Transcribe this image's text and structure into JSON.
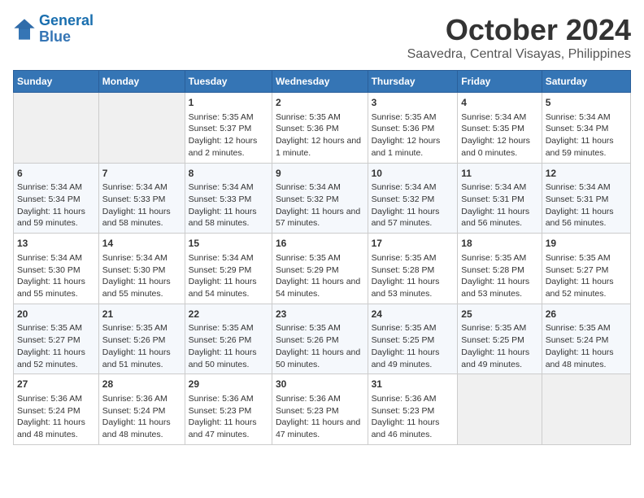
{
  "header": {
    "logo_line1": "General",
    "logo_line2": "Blue",
    "month": "October 2024",
    "location": "Saavedra, Central Visayas, Philippines"
  },
  "days_of_week": [
    "Sunday",
    "Monday",
    "Tuesday",
    "Wednesday",
    "Thursday",
    "Friday",
    "Saturday"
  ],
  "weeks": [
    [
      {
        "day": "",
        "empty": true
      },
      {
        "day": "",
        "empty": true
      },
      {
        "day": "1",
        "sunrise": "Sunrise: 5:35 AM",
        "sunset": "Sunset: 5:37 PM",
        "daylight": "Daylight: 12 hours and 2 minutes."
      },
      {
        "day": "2",
        "sunrise": "Sunrise: 5:35 AM",
        "sunset": "Sunset: 5:36 PM",
        "daylight": "Daylight: 12 hours and 1 minute."
      },
      {
        "day": "3",
        "sunrise": "Sunrise: 5:35 AM",
        "sunset": "Sunset: 5:36 PM",
        "daylight": "Daylight: 12 hours and 1 minute."
      },
      {
        "day": "4",
        "sunrise": "Sunrise: 5:34 AM",
        "sunset": "Sunset: 5:35 PM",
        "daylight": "Daylight: 12 hours and 0 minutes."
      },
      {
        "day": "5",
        "sunrise": "Sunrise: 5:34 AM",
        "sunset": "Sunset: 5:34 PM",
        "daylight": "Daylight: 11 hours and 59 minutes."
      }
    ],
    [
      {
        "day": "6",
        "sunrise": "Sunrise: 5:34 AM",
        "sunset": "Sunset: 5:34 PM",
        "daylight": "Daylight: 11 hours and 59 minutes."
      },
      {
        "day": "7",
        "sunrise": "Sunrise: 5:34 AM",
        "sunset": "Sunset: 5:33 PM",
        "daylight": "Daylight: 11 hours and 58 minutes."
      },
      {
        "day": "8",
        "sunrise": "Sunrise: 5:34 AM",
        "sunset": "Sunset: 5:33 PM",
        "daylight": "Daylight: 11 hours and 58 minutes."
      },
      {
        "day": "9",
        "sunrise": "Sunrise: 5:34 AM",
        "sunset": "Sunset: 5:32 PM",
        "daylight": "Daylight: 11 hours and 57 minutes."
      },
      {
        "day": "10",
        "sunrise": "Sunrise: 5:34 AM",
        "sunset": "Sunset: 5:32 PM",
        "daylight": "Daylight: 11 hours and 57 minutes."
      },
      {
        "day": "11",
        "sunrise": "Sunrise: 5:34 AM",
        "sunset": "Sunset: 5:31 PM",
        "daylight": "Daylight: 11 hours and 56 minutes."
      },
      {
        "day": "12",
        "sunrise": "Sunrise: 5:34 AM",
        "sunset": "Sunset: 5:31 PM",
        "daylight": "Daylight: 11 hours and 56 minutes."
      }
    ],
    [
      {
        "day": "13",
        "sunrise": "Sunrise: 5:34 AM",
        "sunset": "Sunset: 5:30 PM",
        "daylight": "Daylight: 11 hours and 55 minutes."
      },
      {
        "day": "14",
        "sunrise": "Sunrise: 5:34 AM",
        "sunset": "Sunset: 5:30 PM",
        "daylight": "Daylight: 11 hours and 55 minutes."
      },
      {
        "day": "15",
        "sunrise": "Sunrise: 5:34 AM",
        "sunset": "Sunset: 5:29 PM",
        "daylight": "Daylight: 11 hours and 54 minutes."
      },
      {
        "day": "16",
        "sunrise": "Sunrise: 5:35 AM",
        "sunset": "Sunset: 5:29 PM",
        "daylight": "Daylight: 11 hours and 54 minutes."
      },
      {
        "day": "17",
        "sunrise": "Sunrise: 5:35 AM",
        "sunset": "Sunset: 5:28 PM",
        "daylight": "Daylight: 11 hours and 53 minutes."
      },
      {
        "day": "18",
        "sunrise": "Sunrise: 5:35 AM",
        "sunset": "Sunset: 5:28 PM",
        "daylight": "Daylight: 11 hours and 53 minutes."
      },
      {
        "day": "19",
        "sunrise": "Sunrise: 5:35 AM",
        "sunset": "Sunset: 5:27 PM",
        "daylight": "Daylight: 11 hours and 52 minutes."
      }
    ],
    [
      {
        "day": "20",
        "sunrise": "Sunrise: 5:35 AM",
        "sunset": "Sunset: 5:27 PM",
        "daylight": "Daylight: 11 hours and 52 minutes."
      },
      {
        "day": "21",
        "sunrise": "Sunrise: 5:35 AM",
        "sunset": "Sunset: 5:26 PM",
        "daylight": "Daylight: 11 hours and 51 minutes."
      },
      {
        "day": "22",
        "sunrise": "Sunrise: 5:35 AM",
        "sunset": "Sunset: 5:26 PM",
        "daylight": "Daylight: 11 hours and 50 minutes."
      },
      {
        "day": "23",
        "sunrise": "Sunrise: 5:35 AM",
        "sunset": "Sunset: 5:26 PM",
        "daylight": "Daylight: 11 hours and 50 minutes."
      },
      {
        "day": "24",
        "sunrise": "Sunrise: 5:35 AM",
        "sunset": "Sunset: 5:25 PM",
        "daylight": "Daylight: 11 hours and 49 minutes."
      },
      {
        "day": "25",
        "sunrise": "Sunrise: 5:35 AM",
        "sunset": "Sunset: 5:25 PM",
        "daylight": "Daylight: 11 hours and 49 minutes."
      },
      {
        "day": "26",
        "sunrise": "Sunrise: 5:35 AM",
        "sunset": "Sunset: 5:24 PM",
        "daylight": "Daylight: 11 hours and 48 minutes."
      }
    ],
    [
      {
        "day": "27",
        "sunrise": "Sunrise: 5:36 AM",
        "sunset": "Sunset: 5:24 PM",
        "daylight": "Daylight: 11 hours and 48 minutes."
      },
      {
        "day": "28",
        "sunrise": "Sunrise: 5:36 AM",
        "sunset": "Sunset: 5:24 PM",
        "daylight": "Daylight: 11 hours and 48 minutes."
      },
      {
        "day": "29",
        "sunrise": "Sunrise: 5:36 AM",
        "sunset": "Sunset: 5:23 PM",
        "daylight": "Daylight: 11 hours and 47 minutes."
      },
      {
        "day": "30",
        "sunrise": "Sunrise: 5:36 AM",
        "sunset": "Sunset: 5:23 PM",
        "daylight": "Daylight: 11 hours and 47 minutes."
      },
      {
        "day": "31",
        "sunrise": "Sunrise: 5:36 AM",
        "sunset": "Sunset: 5:23 PM",
        "daylight": "Daylight: 11 hours and 46 minutes."
      },
      {
        "day": "",
        "empty": true
      },
      {
        "day": "",
        "empty": true
      }
    ]
  ]
}
